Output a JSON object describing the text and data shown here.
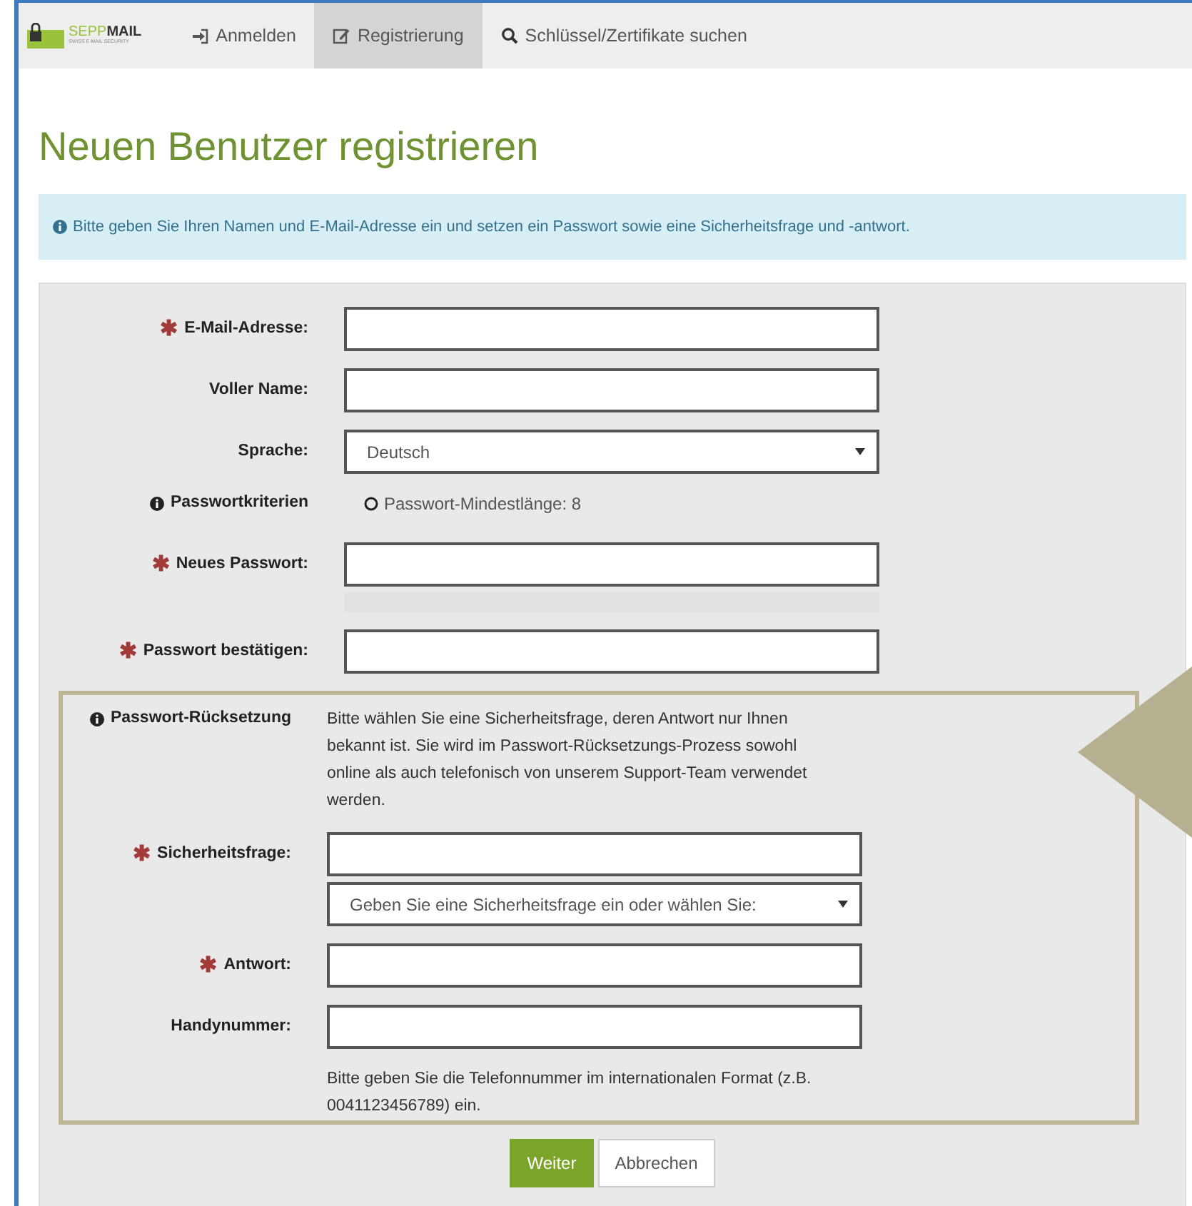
{
  "brand": {
    "name_light": "SEPP",
    "name_bold": "MAIL",
    "tagline": "SWISS E-MAIL SECURITY"
  },
  "nav": [
    {
      "label": "Anmelden",
      "selected": false
    },
    {
      "label": "Registrierung",
      "selected": true
    },
    {
      "label": "Schlüssel/Zertifikate suchen",
      "selected": false
    }
  ],
  "title": "Neuen Benutzer registrieren",
  "alert": "Bitte geben Sie Ihren Namen und E-Mail-Adresse ein und setzen ein Passwort sowie eine Sicherheitsfrage und -antwort.",
  "fields": [
    {
      "kind": "input",
      "label": "E-Mail-Adresse:",
      "marker": "✱"
    },
    {
      "kind": "input",
      "label": "Voller Name:"
    },
    {
      "kind": "select",
      "label": "Sprache:",
      "value": "Deutsch"
    },
    {
      "kind": "criteria",
      "label": "Passwortkriterien",
      "criteria": [
        "Passwort-Mindestlänge: 8"
      ]
    },
    {
      "kind": "input",
      "label": "Neues Passwort:",
      "marker": "✱"
    },
    {
      "kind": "meter"
    },
    {
      "kind": "input",
      "label": "Passwort bestätigen:",
      "marker": "✱"
    }
  ],
  "reset": {
    "label": "Passwort-Rücksetzung",
    "text": "Bitte wählen Sie eine Sicherheitsfrage, deren Antwort nur Ihnen bekannt ist. Sie wird im Passwort-Rücksetzungs-Prozess sowohl online als auch telefonisch von unserem Support-Team verwendet werden.",
    "fields": [
      {
        "kind": "input",
        "label": "Sicherheitsfrage:",
        "marker": "✱"
      },
      {
        "kind": "select",
        "value": "Geben Sie eine Sicherheitsfrage ein oder wählen Sie:"
      },
      {
        "kind": "input",
        "label": "Antwort:",
        "marker": "✱"
      },
      {
        "kind": "input",
        "label": "Handynummer:"
      },
      {
        "kind": "help",
        "text": "Bitte geben Sie die Telefonnummer im internationalen Format (z.B. 0041123456789) ein."
      }
    ]
  },
  "buttons": [
    {
      "label": "Weiter",
      "kind": "primary"
    },
    {
      "label": "Abbrechen",
      "kind": "secondary"
    }
  ]
}
